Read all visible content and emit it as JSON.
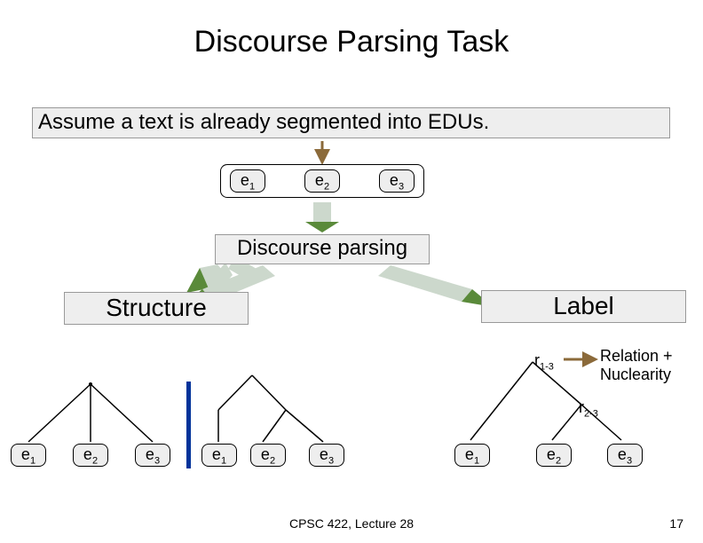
{
  "title": "Discourse Parsing Task",
  "assume_text": "Assume a text is already segmented into EDUs.",
  "edus": {
    "e1": "e",
    "e1s": "1",
    "e2": "e",
    "e2s": "2",
    "e3": "e",
    "e3s": "3"
  },
  "parsing_label": "Discourse parsing",
  "structure_label": "Structure",
  "label_label": "Label",
  "r13": "r",
  "r13s": "1-3",
  "r23": "r",
  "r23s": "2-3",
  "rn_line1": "Relation +",
  "rn_line2": "Nuclearity",
  "footer_center": "CPSC 422, Lecture 28",
  "footer_right": "17"
}
